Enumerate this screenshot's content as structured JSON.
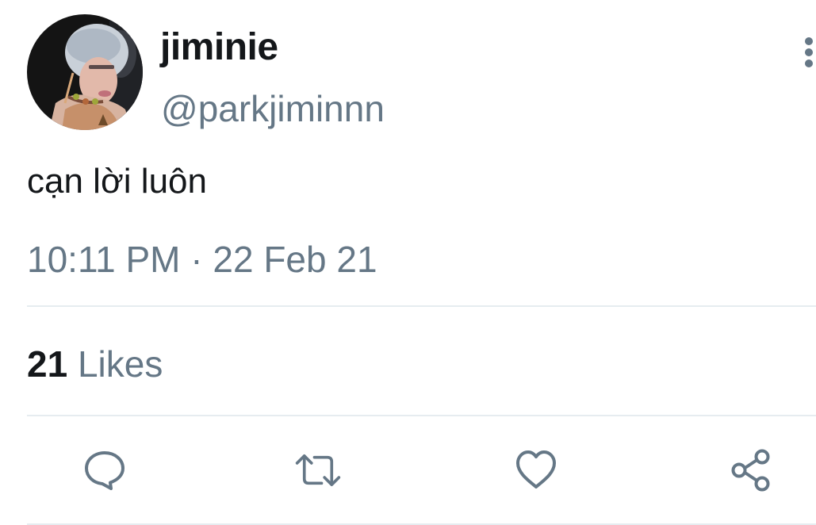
{
  "user": {
    "display_name": "jiminie",
    "handle": "@parkjiminnn"
  },
  "tweet": {
    "text": "cạn lời luôn",
    "time": "10:11 PM",
    "separator": " · ",
    "date": "22 Feb 21"
  },
  "stats": {
    "likes_count": "21",
    "likes_label": " Likes"
  },
  "actions": {
    "reply_icon": "comment-bubble-icon",
    "retweet_icon": "retweet-arrows-icon",
    "like_icon": "heart-icon",
    "share_icon": "share-nodes-icon",
    "more_icon": "vertical-dots-icon"
  },
  "colors": {
    "text_primary": "#14171a",
    "text_secondary": "#657786",
    "divider": "#e6ecf0",
    "icon": "#657786"
  }
}
